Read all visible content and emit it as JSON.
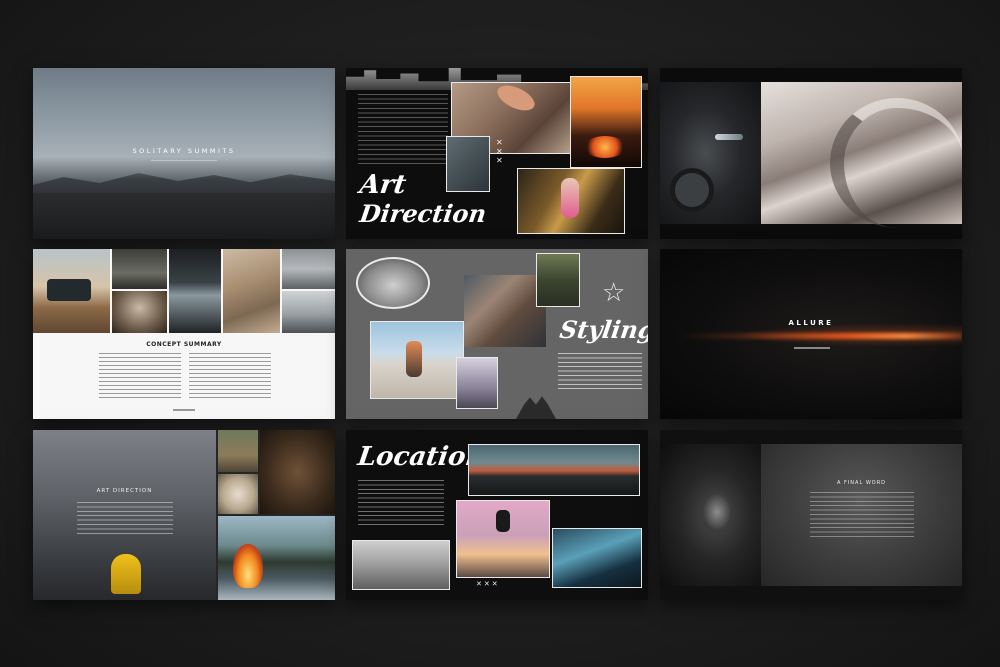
{
  "slides": {
    "s1": {
      "title": "SOLITARY SUMMITS"
    },
    "s2": {
      "title_line1": "Art",
      "title_line2": "Direction"
    },
    "s3": {},
    "s4": {
      "heading": "CONCEPT SUMMARY"
    },
    "s5": {
      "title": "Styling"
    },
    "s6": {
      "title": "ALLURE"
    },
    "s7": {
      "heading": "ART DIRECTION"
    },
    "s8": {
      "title": "Locations"
    },
    "s9": {
      "heading": "A FINAL WORD"
    }
  },
  "colors": {
    "background": "#1d1d1d",
    "accent_orange": "#e0561c",
    "paper_white": "#f7f7f7",
    "frame_white": "#e9e9e9"
  },
  "icons": [
    "star-outline-icon",
    "x-marks-icon"
  ]
}
